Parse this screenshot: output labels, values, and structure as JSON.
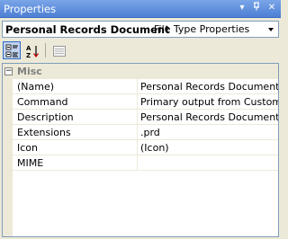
{
  "window": {
    "title": "Properties"
  },
  "object_selector": {
    "name": "Personal Records Document",
    "type": "File Type Properties"
  },
  "toolbar": {
    "categorized_icon": "categorized-icon",
    "alphabetical_icon": "alphabetical-icon",
    "property_pages_icon": "property-pages-icon"
  },
  "grid": {
    "category": {
      "toggle": "⊟",
      "label": "Misc"
    },
    "rows": [
      {
        "name": "(Name)",
        "value": "Personal Records Document"
      },
      {
        "name": "Command",
        "value": "Primary output from CustomFileT"
      },
      {
        "name": "Description",
        "value": "Personal Records Document"
      },
      {
        "name": "Extensions",
        "value": ".prd"
      },
      {
        "name": "Icon",
        "value": "(Icon)"
      },
      {
        "name": "MIME",
        "value": ""
      }
    ]
  }
}
